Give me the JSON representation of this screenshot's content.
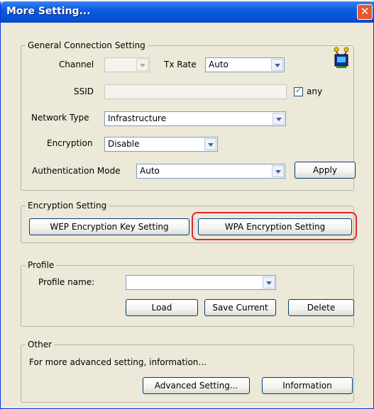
{
  "window": {
    "title": "More Setting..."
  },
  "general": {
    "legend": "General Connection Setting",
    "channel_label": "Channel",
    "channel_value": "",
    "tx_rate_label": "Tx Rate",
    "tx_rate_value": "Auto",
    "ssid_label": "SSID",
    "ssid_value": "",
    "any_label": "any",
    "network_type_label": "Network Type",
    "network_type_value": "Infrastructure",
    "encryption_label": "Encryption",
    "encryption_value": "Disable",
    "auth_label": "Authentication Mode",
    "auth_value": "Auto",
    "apply_label": "Apply"
  },
  "encryption": {
    "legend": "Encryption Setting",
    "wep_button": "WEP Encryption Key Setting",
    "wpa_button": "WPA Encryption Setting"
  },
  "profile": {
    "legend": "Profile",
    "name_label": "Profile name:",
    "name_value": "",
    "load": "Load",
    "save": "Save Current",
    "delete": "Delete"
  },
  "other": {
    "legend": "Other",
    "text": "For more advanced setting, information...",
    "advanced": "Advanced Setting...",
    "information": "Information"
  },
  "colors": {
    "highlight": "#e1262d",
    "titlebar": "#0a5ddf"
  }
}
